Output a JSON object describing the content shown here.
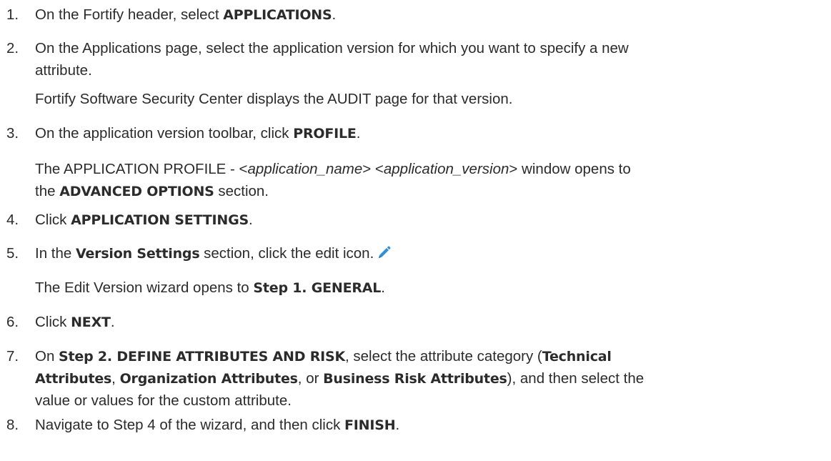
{
  "steps": [
    {
      "number": "1.",
      "lines": [
        [
          {
            "t": "On the Fortify header, select "
          },
          {
            "t": "APPLICATIONS",
            "s": "b"
          },
          {
            "t": "."
          }
        ]
      ]
    },
    {
      "number": "2.",
      "lines": [
        [
          {
            "t": "On the Applications page, select the application version for which you want to specify a new"
          }
        ],
        [
          {
            "t": "attribute."
          }
        ]
      ]
    },
    {
      "number": "",
      "lines": [
        [
          {
            "t": "Fortify Software Security Center displays the AUDIT page for that version."
          }
        ]
      ]
    },
    {
      "number": "3.",
      "lines": [
        [
          {
            "t": "On the application version toolbar, click "
          },
          {
            "t": "PROFILE",
            "s": "b"
          },
          {
            "t": "."
          }
        ]
      ]
    },
    {
      "number": "",
      "lines": [
        [
          {
            "t": "The APPLICATION PROFILE - <"
          },
          {
            "t": "application_name",
            "s": "i"
          },
          {
            "t": "> <"
          },
          {
            "t": "application_version",
            "s": "i"
          },
          {
            "t": "> window opens to"
          }
        ],
        [
          {
            "t": "the "
          },
          {
            "t": "ADVANCED OPTIONS",
            "s": "b"
          },
          {
            "t": " section."
          }
        ]
      ]
    },
    {
      "number": "4.",
      "lines": [
        [
          {
            "t": "Click "
          },
          {
            "t": "APPLICATION SETTINGS",
            "s": "b"
          },
          {
            "t": "."
          }
        ]
      ]
    },
    {
      "number": "5.",
      "lines": [
        [
          {
            "t": "In the "
          },
          {
            "t": "Version Settings",
            "s": "b"
          },
          {
            "t": " section, click the edit icon."
          },
          {
            "icon": "pencil-icon"
          }
        ]
      ]
    },
    {
      "number": "",
      "lines": [
        [
          {
            "t": "The Edit Version wizard opens to "
          },
          {
            "t": "Step 1. GENERAL",
            "s": "b"
          },
          {
            "t": "."
          }
        ]
      ]
    },
    {
      "number": "6.",
      "lines": [
        [
          {
            "t": "Click "
          },
          {
            "t": "NEXT",
            "s": "b"
          },
          {
            "t": "."
          }
        ]
      ]
    },
    {
      "number": "7.",
      "lines": [
        [
          {
            "t": "On "
          },
          {
            "t": "Step 2. DEFINE ATTRIBUTES AND RISK",
            "s": "b"
          },
          {
            "t": ", select the attribute category ("
          },
          {
            "t": "Technical",
            "s": "b"
          }
        ],
        [
          {
            "t": "Attributes",
            "s": "b"
          },
          {
            "t": ", "
          },
          {
            "t": "Organization Attributes",
            "s": "b"
          },
          {
            "t": ", or "
          },
          {
            "t": "Business Risk Attributes",
            "s": "b"
          },
          {
            "t": "), and then select the"
          }
        ],
        [
          {
            "t": "value or values for the custom attribute."
          }
        ]
      ]
    },
    {
      "number": "8.",
      "lines": [
        [
          {
            "t": "Navigate to Step 4 of the wizard, and then click "
          },
          {
            "t": "FINISH",
            "s": "b"
          },
          {
            "t": "."
          }
        ]
      ]
    }
  ],
  "icon_color": "#2f8fd8"
}
